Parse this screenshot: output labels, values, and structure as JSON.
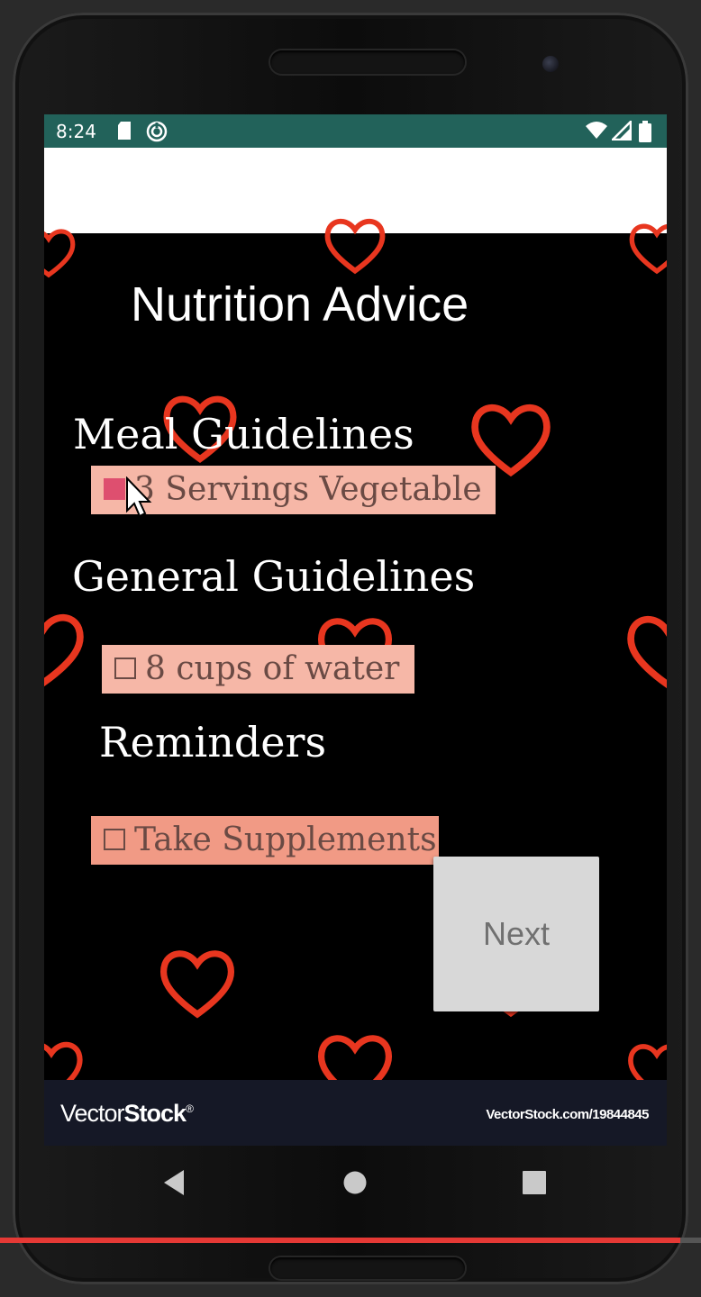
{
  "statusbar": {
    "time": "8:24",
    "left_icons": [
      "sd-card-icon",
      "sync-icon"
    ],
    "right_icons": [
      "wifi-icon",
      "signal-icon",
      "battery-icon"
    ],
    "color": "#22625a"
  },
  "screen": {
    "title": "Nutrition Advice",
    "sections": [
      {
        "heading": "Meal Guidelines",
        "item": {
          "label": "3 Servings Vegetable",
          "checked": true
        }
      },
      {
        "heading": "General Guidelines",
        "item": {
          "label": "8 cups of water",
          "checked": false
        }
      },
      {
        "heading": "Reminders",
        "item": {
          "label": "Take Supplements",
          "checked": false
        }
      }
    ],
    "next_label": "Next",
    "background_pattern": "heart-icon",
    "checkbox_bg": "#f6b7a7",
    "checked_color": "#de4f6f"
  },
  "ad": {
    "logo_regular": "Vector",
    "logo_bold": "Stock",
    "logo_mark": "®",
    "url": "VectorStock.com/19844845"
  },
  "navbar": {
    "buttons": [
      "back-icon",
      "home-icon",
      "recents-icon"
    ]
  },
  "video_progress": {
    "fraction": 0.97,
    "color": "#e53935"
  }
}
